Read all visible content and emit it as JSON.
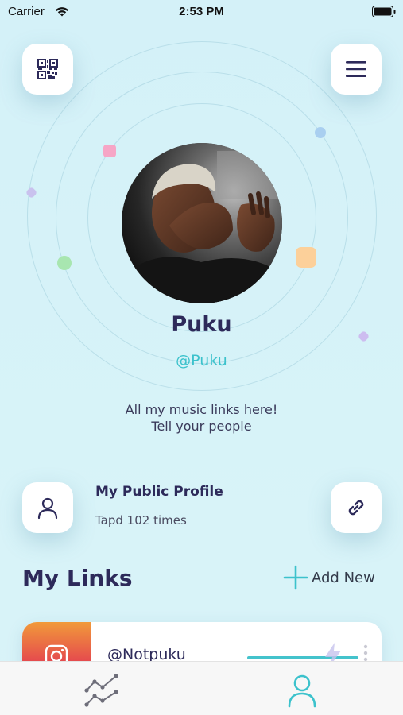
{
  "status_bar": {
    "carrier": "Carrier",
    "time": "2:53 PM"
  },
  "header": {
    "qr_button_icon": "qr-code-icon",
    "menu_button_icon": "hamburger-menu-icon"
  },
  "profile": {
    "name": "Puku",
    "handle": "@Puku",
    "bio_line1": "All my music links here!",
    "bio_line2": "Tell your people"
  },
  "public_profile": {
    "title": "My Public Profile",
    "subtitle": "Tapd 102 times",
    "profile_icon": "user-icon",
    "share_icon": "link-icon"
  },
  "links_section": {
    "title": "My Links",
    "add_label": "Add New"
  },
  "links": [
    {
      "platform_icon": "instagram-icon",
      "label": "@Notpuku"
    }
  ],
  "tab_bar": {
    "tabs": [
      {
        "icon": "stats-icon",
        "active": false
      },
      {
        "icon": "profile-icon",
        "active": true
      }
    ]
  },
  "colors": {
    "background": "#d6f2f7",
    "primary_text": "#2d2a5a",
    "accent": "#3cc2cc",
    "instagram_gradient_top": "#f19a3a",
    "instagram_gradient_bottom": "#d8346a"
  }
}
